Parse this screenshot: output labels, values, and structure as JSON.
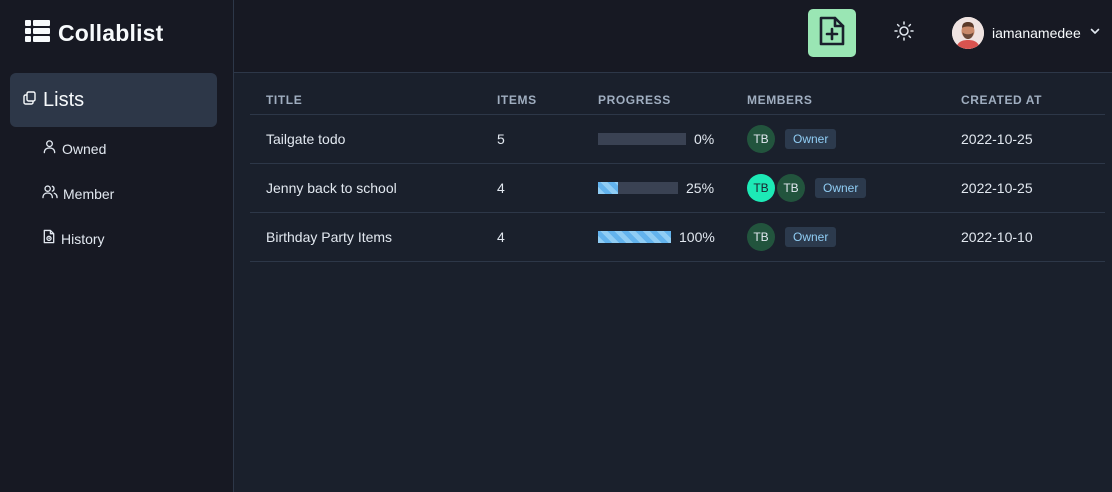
{
  "app": {
    "title": "Collablist"
  },
  "sidebar": {
    "lists_label": "Lists",
    "items": [
      {
        "label": "Owned",
        "icon": "user-icon"
      },
      {
        "label": "Member",
        "icon": "users-icon"
      },
      {
        "label": "History",
        "icon": "history-file-icon"
      }
    ]
  },
  "topbar": {
    "new_list_icon": "file-plus-icon",
    "theme_icon": "sun-icon",
    "username": "iamanamedee"
  },
  "table": {
    "headers": [
      "Title",
      "Items",
      "Progress",
      "Members",
      "Created At"
    ],
    "rows": [
      {
        "title": "Tailgate todo",
        "items": "5",
        "progress": 0,
        "progress_label": "0%",
        "members": [
          {
            "initials": "TB",
            "color": "#22543d",
            "text": "#e2e8f0"
          }
        ],
        "role": "Owner",
        "created": "2022-10-25"
      },
      {
        "title": "Jenny back to school",
        "items": "4",
        "progress": 0.25,
        "progress_label": "25%",
        "members": [
          {
            "initials": "TB",
            "color": "#1de9b6",
            "text": "#1a202c"
          },
          {
            "initials": "TB",
            "color": "#22543d",
            "text": "#e2e8f0"
          }
        ],
        "role": "Owner",
        "created": "2022-10-25"
      },
      {
        "title": "Birthday Party Items",
        "items": "4",
        "progress": 1,
        "progress_label": "100%",
        "members": [
          {
            "initials": "TB",
            "color": "#22543d",
            "text": "#e2e8f0"
          }
        ],
        "role": "Owner",
        "created": "2022-10-10"
      }
    ]
  },
  "colors": {
    "background": "#1a202c",
    "sidebar": "#171923",
    "accent_green": "#9ae6b4",
    "progress_fill": "#90cdf4"
  }
}
